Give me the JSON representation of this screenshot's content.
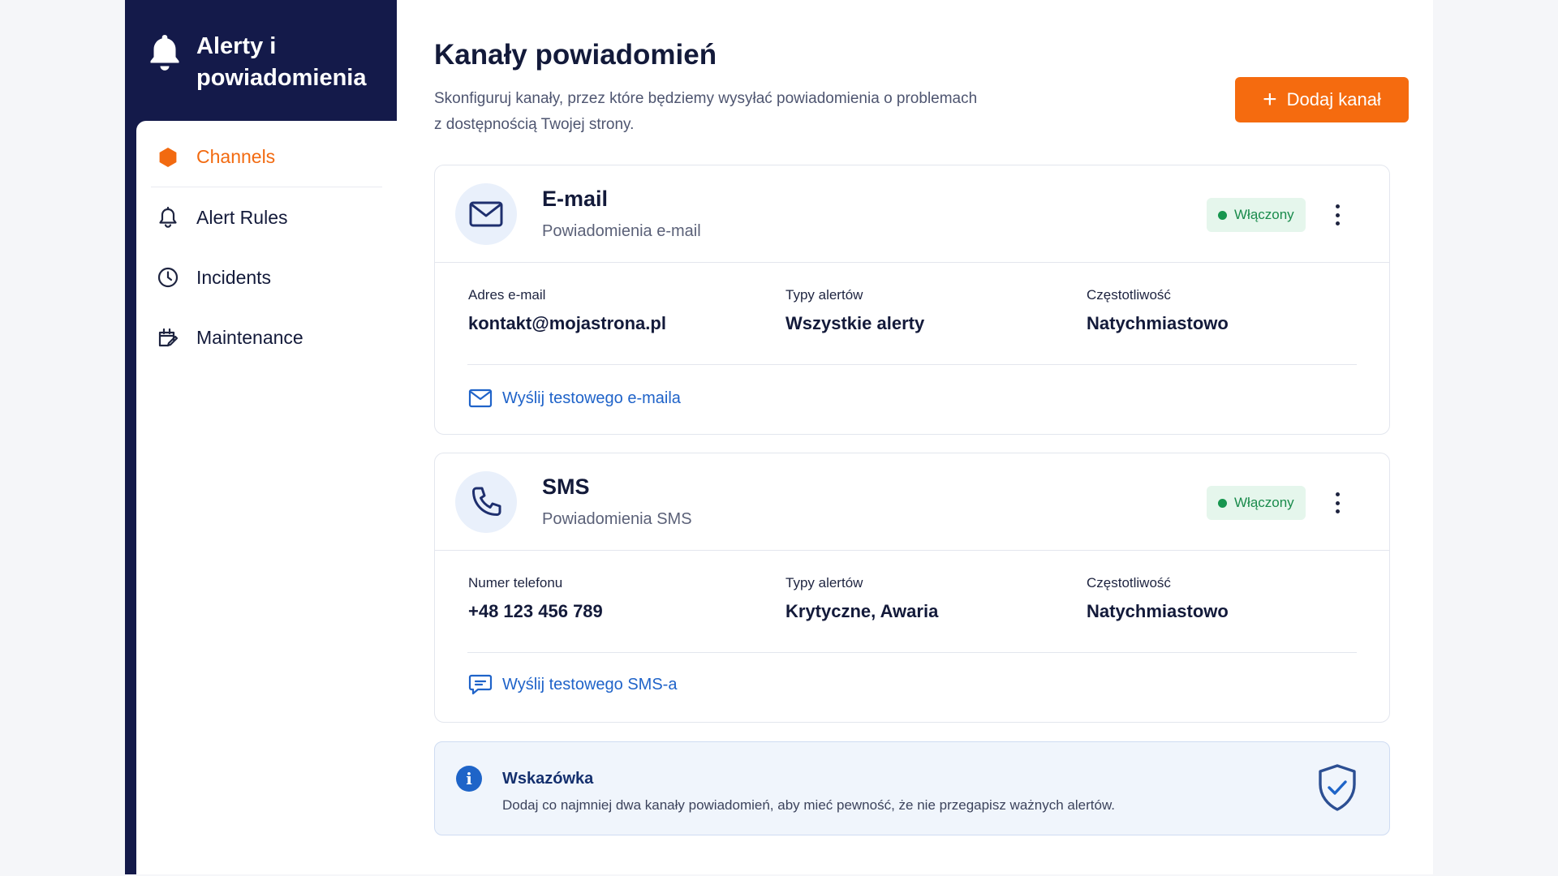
{
  "sidebar": {
    "title": "Alerty i powiadomienia",
    "items": [
      {
        "label": "Channels",
        "icon": "hexagon-icon",
        "active": true
      },
      {
        "label": "Alert Rules",
        "icon": "bell-icon"
      },
      {
        "label": "Incidents",
        "icon": "clock-icon"
      },
      {
        "label": "Maintenance",
        "icon": "wrench-calendar-icon"
      }
    ]
  },
  "header": {
    "title": "Kanały powiadomień",
    "subtitle": "Skonfiguruj kanały, przez które będziemy wysyłać powiadomienia o problemach z dostępnością Twojej strony.",
    "add_label": "Dodaj kanał"
  },
  "channels": [
    {
      "name": "E-mail",
      "description": "Powiadomienia e-mail",
      "status": "Włączony",
      "fields": [
        {
          "label": "Adres e-mail",
          "value": "kontakt@mojastrona.pl"
        },
        {
          "label": "Typy alertów",
          "value": "Wszystkie alerty"
        },
        {
          "label": "Częstotliwość",
          "value": "Natychmiastowo"
        }
      ],
      "test_label": "Wyślij testowego e-maila"
    },
    {
      "name": "SMS",
      "description": "Powiadomienia SMS",
      "status": "Włączony",
      "fields": [
        {
          "label": "Numer telefonu",
          "value": "+48 123 456 789"
        },
        {
          "label": "Typy alertów",
          "value": "Krytyczne, Awaria"
        },
        {
          "label": "Częstotliwość",
          "value": "Natychmiastowo"
        }
      ],
      "test_label": "Wyślij testowego SMS-a"
    }
  ],
  "tip": {
    "title": "Wskazówka",
    "text": "Dodaj co najmniej dwa kanały powiadomień, aby mieć pewność, że nie przegapisz ważnych alertów."
  },
  "colors": {
    "sidebar_bg": "#141a4a",
    "accent": "#f56b0f",
    "link": "#1f63c9",
    "status_green": "#1a8b4c"
  }
}
